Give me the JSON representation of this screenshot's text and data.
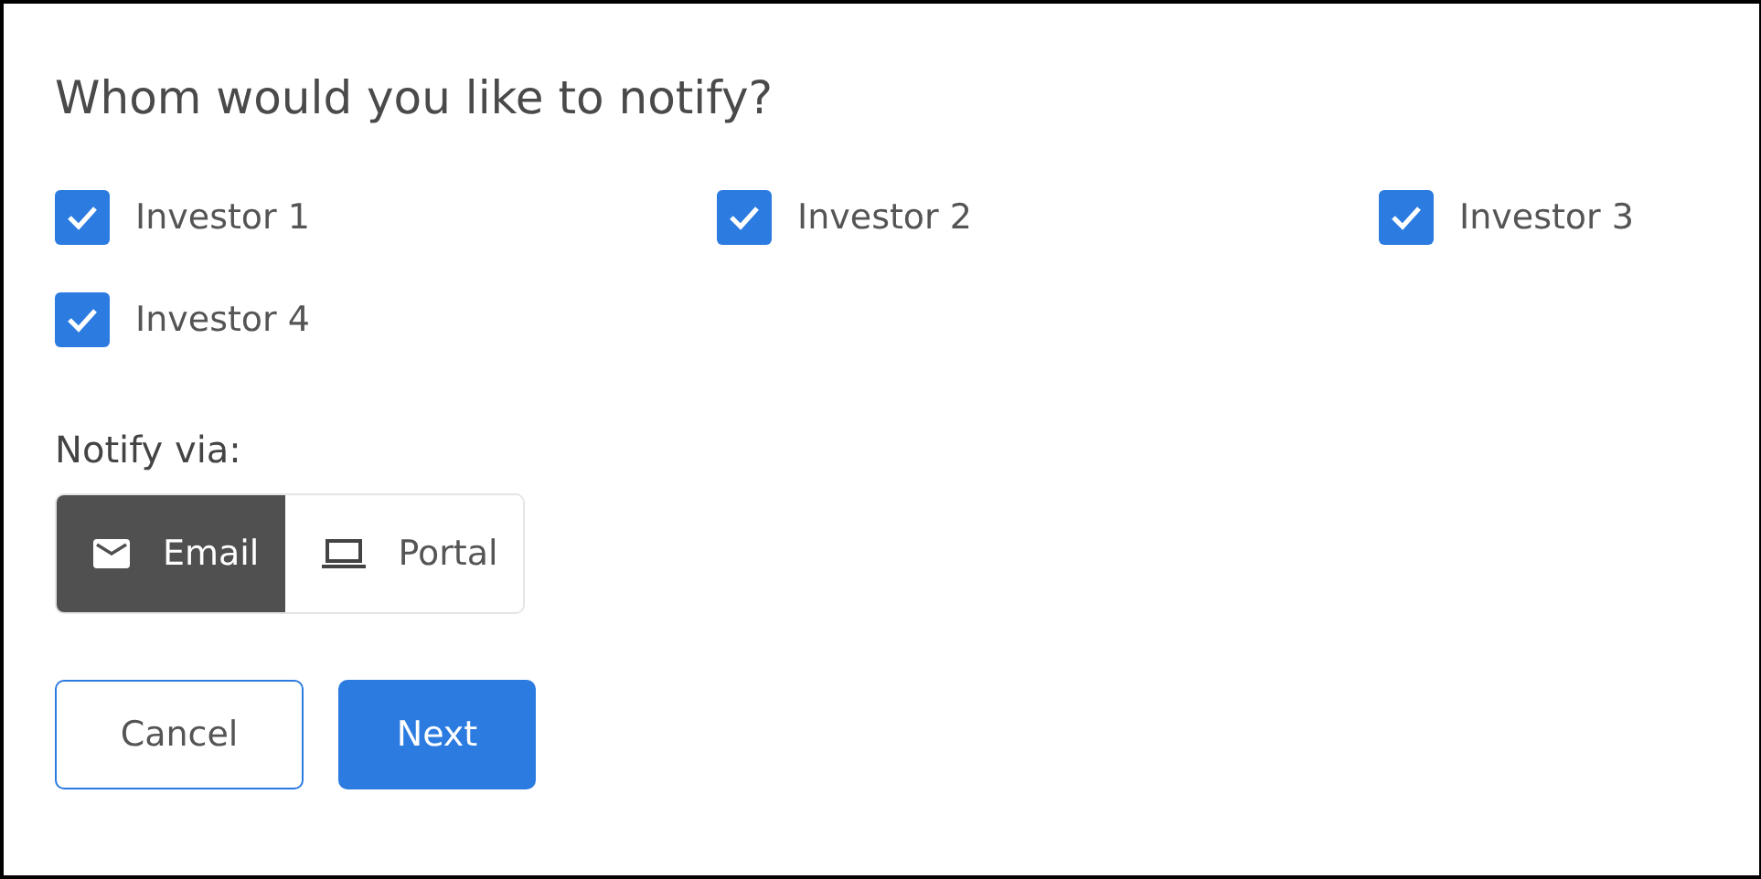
{
  "title": "Whom would you like to notify?",
  "recipients": [
    {
      "label": "Investor 1",
      "checked": true
    },
    {
      "label": "Investor 2",
      "checked": true
    },
    {
      "label": "Investor 3",
      "checked": true
    },
    {
      "label": "Investor 4",
      "checked": true
    }
  ],
  "notify_via": {
    "label": "Notify via:",
    "options": [
      {
        "kind": "email",
        "label": "Email",
        "selected": true
      },
      {
        "kind": "portal",
        "label": "Portal",
        "selected": false
      }
    ]
  },
  "buttons": [
    {
      "kind": "secondary",
      "label": "Cancel"
    },
    {
      "kind": "primary",
      "label": "Next"
    }
  ]
}
